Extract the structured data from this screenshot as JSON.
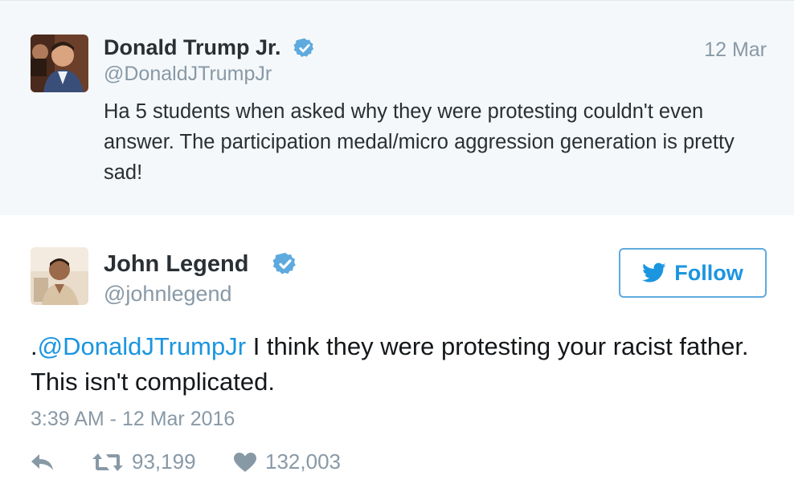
{
  "quoted_tweet": {
    "author_name": "Donald Trump Jr.",
    "author_handle": "@DonaldJTrumpJr",
    "date": "12 Mar",
    "text": "Ha 5 students when asked why they were protesting couldn't even answer. The participation medal/micro aggression generation is pretty sad!"
  },
  "main_tweet": {
    "author_name": "John Legend",
    "author_handle": "@johnlegend",
    "follow_label": "Follow",
    "mention": "@DonaldJTrumpJr",
    "text_prefix": ".",
    "text_rest": " I think they were protesting your racist father. This isn't complicated.",
    "timestamp": "3:39 AM - 12 Mar 2016",
    "retweet_count": "93,199",
    "like_count": "132,003"
  },
  "icons": {
    "verified": "verified-badge-icon",
    "bird": "twitter-bird-icon",
    "reply": "reply-icon",
    "retweet": "retweet-icon",
    "like": "heart-icon"
  },
  "colors": {
    "accent": "#1b95e0",
    "verified": "#5eaade",
    "muted": "#8899a6",
    "quoted_bg": "#f5f8fa"
  }
}
